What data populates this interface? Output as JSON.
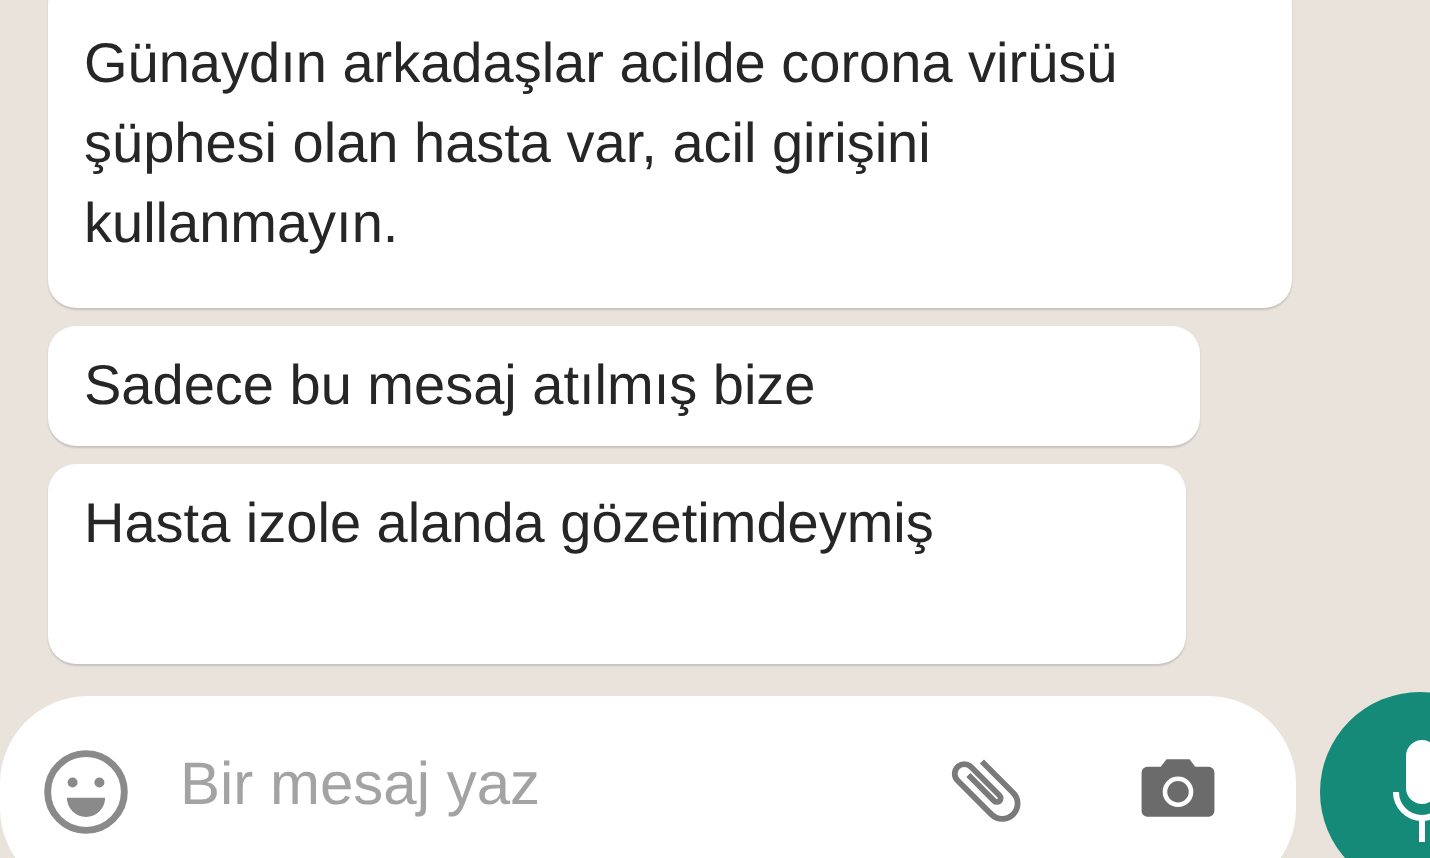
{
  "messages": [
    {
      "text": "Günaydın arkadaşlar acilde corona virüsü şüphesi olan hasta var, acil girişini kullanmayın."
    },
    {
      "text": "Sadece bu mesaj atılmış bize"
    },
    {
      "text": "Hasta izole alanda gözetimdeymiş"
    }
  ],
  "composer": {
    "placeholder": "Bir mesaj yaz"
  }
}
